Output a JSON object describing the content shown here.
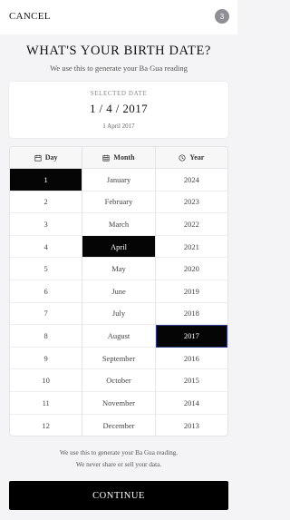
{
  "header": {
    "cancel_label": "CANCEL",
    "step_number": "3"
  },
  "page": {
    "title": "WHAT'S YOUR BIRTH DATE?",
    "subtitle": "We use this to generate your Ba Gua reading"
  },
  "selected": {
    "label": "SELECTED DATE",
    "value": "1 / 4 / 2017",
    "long": "1 April 2017"
  },
  "picker": {
    "headers": {
      "day": "Day",
      "month": "Month",
      "year": "Year"
    },
    "days": [
      "1",
      "2",
      "3",
      "4",
      "5",
      "6",
      "7",
      "8",
      "9",
      "10",
      "11",
      "12"
    ],
    "months": [
      "January",
      "February",
      "March",
      "April",
      "May",
      "June",
      "July",
      "August",
      "September",
      "October",
      "November",
      "December"
    ],
    "years": [
      "2024",
      "2023",
      "2022",
      "2021",
      "2020",
      "2019",
      "2018",
      "2017",
      "2016",
      "2015",
      "2014",
      "2013"
    ],
    "selected_day": "1",
    "selected_month": "April",
    "selected_year": "2017"
  },
  "privacy": {
    "line1": "We use this to generate your Ba Gua reading.",
    "line2": "We never share or sell your data."
  },
  "footer": {
    "continue_label": "CONTINUE"
  },
  "colors": {
    "selected_bg": "#050505",
    "year_focus_border": "#2a3a8c",
    "badge_bg": "#8e8e95"
  }
}
